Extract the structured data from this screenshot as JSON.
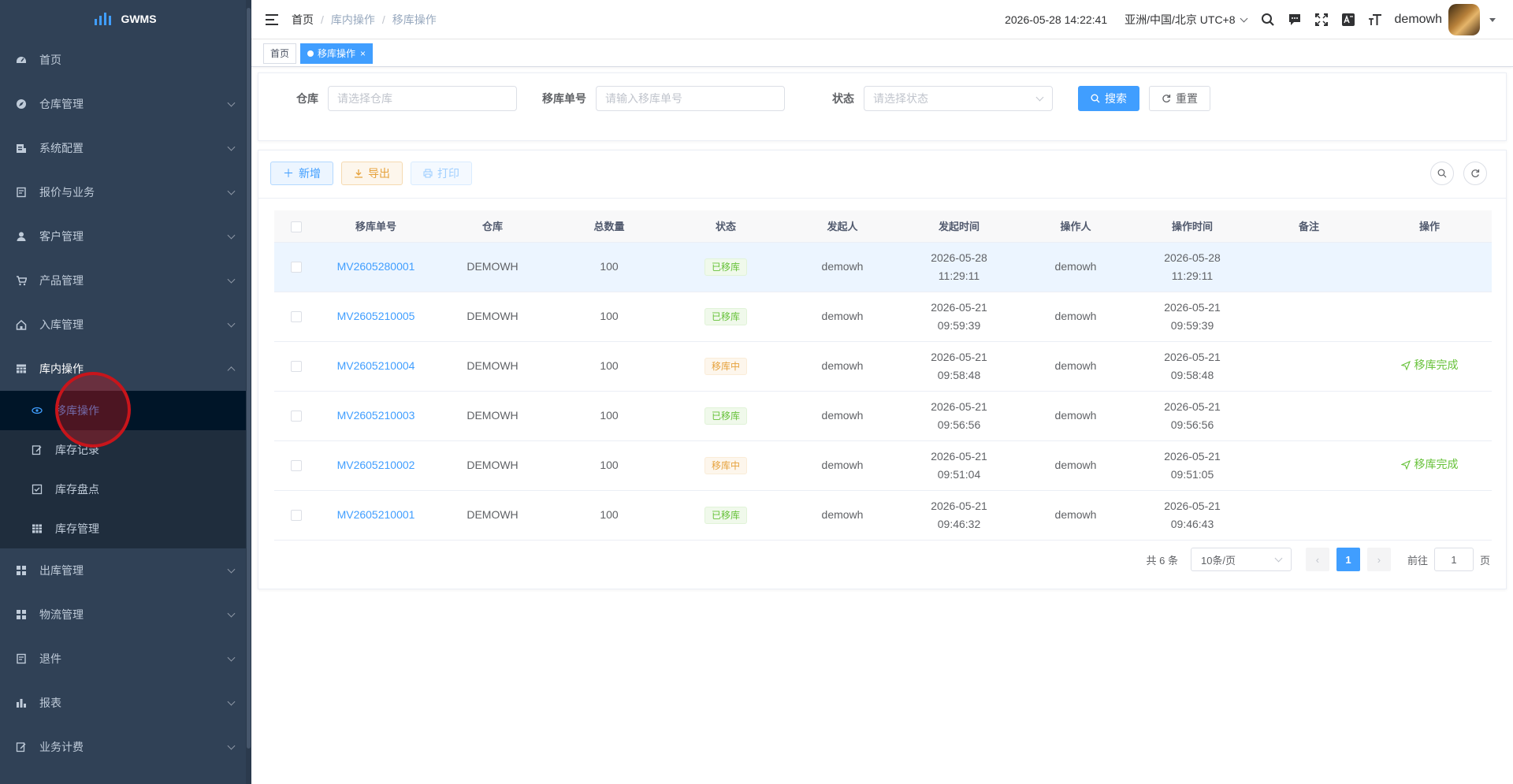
{
  "app": {
    "name": "GWMS"
  },
  "sidebar": {
    "items": [
      {
        "label": "首页",
        "icon": "dashboard-icon"
      },
      {
        "label": "仓库管理",
        "icon": "compass-icon"
      },
      {
        "label": "系统配置",
        "icon": "config-icon"
      },
      {
        "label": "报价与业务",
        "icon": "clipboard-icon"
      },
      {
        "label": "客户管理",
        "icon": "user-icon"
      },
      {
        "label": "产品管理",
        "icon": "cart-icon"
      },
      {
        "label": "入库管理",
        "icon": "home-icon"
      },
      {
        "label": "库内操作",
        "icon": "table-icon"
      }
    ],
    "sub_items": [
      {
        "label": "移库操作",
        "icon": "eye-icon"
      },
      {
        "label": "库存记录",
        "icon": "edit-icon"
      },
      {
        "label": "库存盘点",
        "icon": "checkbox-icon"
      },
      {
        "label": "库存管理",
        "icon": "grid-icon"
      }
    ],
    "items_after": [
      {
        "label": "出库管理",
        "icon": "apps-icon"
      },
      {
        "label": "物流管理",
        "icon": "apps-icon"
      },
      {
        "label": "退件",
        "icon": "clipboard-icon"
      },
      {
        "label": "报表",
        "icon": "chart-icon"
      },
      {
        "label": "业务计费",
        "icon": "edit-icon"
      }
    ]
  },
  "header": {
    "breadcrumb": [
      "首页",
      "库内操作",
      "移库操作"
    ],
    "datetime": "2026-05-28 14:22:41",
    "timezone": "亚洲/中国/北京 UTC+8",
    "username": "demowh"
  },
  "tags": {
    "home": "首页",
    "active": "移库操作"
  },
  "search": {
    "warehouse_label": "仓库",
    "warehouse_placeholder": "请选择仓库",
    "order_label": "移库单号",
    "order_placeholder": "请输入移库单号",
    "status_label": "状态",
    "status_placeholder": "请选择状态",
    "search_btn": "搜索",
    "reset_btn": "重置"
  },
  "toolbar": {
    "add": "新增",
    "export": "导出",
    "print": "打印"
  },
  "table": {
    "columns": [
      "移库单号",
      "仓库",
      "总数量",
      "状态",
      "发起人",
      "发起时间",
      "操作人",
      "操作时间",
      "备注",
      "操作"
    ],
    "rows": [
      {
        "order": "MV2605280001",
        "warehouse": "DEMOWH",
        "qty": "100",
        "status": "已移库",
        "status_type": "done",
        "creator": "demowh",
        "create_date": "2026-05-28",
        "create_time": "11:29:11",
        "operator": "demowh",
        "op_date": "2026-05-28",
        "op_time": "11:29:11",
        "remark": "",
        "action": ""
      },
      {
        "order": "MV2605210005",
        "warehouse": "DEMOWH",
        "qty": "100",
        "status": "已移库",
        "status_type": "done",
        "creator": "demowh",
        "create_date": "2026-05-21",
        "create_time": "09:59:39",
        "operator": "demowh",
        "op_date": "2026-05-21",
        "op_time": "09:59:39",
        "remark": "",
        "action": ""
      },
      {
        "order": "MV2605210004",
        "warehouse": "DEMOWH",
        "qty": "100",
        "status": "移库中",
        "status_type": "moving",
        "creator": "demowh",
        "create_date": "2026-05-21",
        "create_time": "09:58:48",
        "operator": "demowh",
        "op_date": "2026-05-21",
        "op_time": "09:58:48",
        "remark": "",
        "action": "移库完成"
      },
      {
        "order": "MV2605210003",
        "warehouse": "DEMOWH",
        "qty": "100",
        "status": "已移库",
        "status_type": "done",
        "creator": "demowh",
        "create_date": "2026-05-21",
        "create_time": "09:56:56",
        "operator": "demowh",
        "op_date": "2026-05-21",
        "op_time": "09:56:56",
        "remark": "",
        "action": ""
      },
      {
        "order": "MV2605210002",
        "warehouse": "DEMOWH",
        "qty": "100",
        "status": "移库中",
        "status_type": "moving",
        "creator": "demowh",
        "create_date": "2026-05-21",
        "create_time": "09:51:04",
        "operator": "demowh",
        "op_date": "2026-05-21",
        "op_time": "09:51:05",
        "remark": "",
        "action": "移库完成"
      },
      {
        "order": "MV2605210001",
        "warehouse": "DEMOWH",
        "qty": "100",
        "status": "已移库",
        "status_type": "done",
        "creator": "demowh",
        "create_date": "2026-05-21",
        "create_time": "09:46:32",
        "operator": "demowh",
        "op_date": "2026-05-21",
        "op_time": "09:46:43",
        "remark": "",
        "action": ""
      }
    ]
  },
  "pagination": {
    "total": "共 6 条",
    "page_size": "10条/页",
    "current": "1",
    "goto_label": "前往",
    "goto_value": "1",
    "page_suffix": "页"
  },
  "colors": {
    "primary": "#409eff",
    "success": "#67c23a",
    "warning": "#e6a23c",
    "sidebar": "#304156"
  }
}
